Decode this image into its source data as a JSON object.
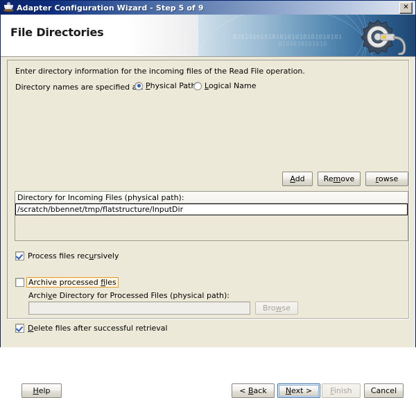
{
  "window": {
    "title": "Adapter Configuration Wizard - Step 5 of 9",
    "icon": "coffee-cup-icon",
    "close_label": "✕"
  },
  "banner": {
    "heading": "File Directories",
    "bits_row1": "0101010101010101010101010101",
    "bits_row2": "0101010101010",
    "graphic": "gear-and-plug-icon"
  },
  "body": {
    "intro_text": "Enter directory information for the incoming files of the Read File operation.",
    "spec_label": "Directory names are specified as:",
    "radios": [
      {
        "label_pre": "",
        "mnemonic": "P",
        "label_post": "hysical Path",
        "selected": true
      },
      {
        "label_pre": "",
        "mnemonic": "L",
        "label_post": "ogical Name",
        "selected": false
      }
    ]
  },
  "list_buttons": {
    "add": {
      "pre": "",
      "mnemonic": "A",
      "post": "dd"
    },
    "remove": {
      "pre": "Re",
      "mnemonic": "m",
      "post": "ove"
    },
    "browse": {
      "pre": "B",
      "mnemonic": "r",
      "post": "owse"
    }
  },
  "directory_table": {
    "column_header": "Directory for Incoming Files (physical path):",
    "rows": [
      {
        "path": "/scratch/bbennet/tmp/flatstructure/InputDir",
        "editing": true
      }
    ]
  },
  "options": {
    "process_recursively": {
      "pre": "Process files rec",
      "mnemonic": "u",
      "post": "rsively",
      "checked": true,
      "focused": false
    },
    "archive_processed": {
      "pre": "Archive processed ",
      "mnemonic": "f",
      "post": "iles",
      "checked": false,
      "focused": true
    },
    "delete_after_retrieval": {
      "pre": "",
      "mnemonic": "D",
      "post": "elete files after successful retrieval",
      "checked": true,
      "focused": false
    }
  },
  "archive_section": {
    "label_pre": "Archi",
    "label_mnemonic": "v",
    "label_post": "e Directory for Processed Files (physical path):",
    "field_value": "",
    "field_placeholder": "",
    "field_enabled": false,
    "browse": {
      "pre": "Bro",
      "mnemonic": "w",
      "post": "se",
      "enabled": false
    }
  },
  "footer_buttons": {
    "help": {
      "pre": "",
      "mnemonic": "H",
      "post": "elp",
      "enabled": true,
      "focused": false
    },
    "back": {
      "pre": "< ",
      "mnemonic": "B",
      "post": "ack",
      "enabled": true,
      "focused": false
    },
    "next": {
      "pre": "",
      "mnemonic": "N",
      "post": "ext >",
      "enabled": true,
      "focused": true
    },
    "finish": {
      "pre": "",
      "mnemonic": "F",
      "post": "inish",
      "enabled": false,
      "focused": false
    },
    "cancel": {
      "pre": "Cancel",
      "mnemonic": "",
      "post": "",
      "enabled": true,
      "focused": false
    }
  },
  "colors": {
    "titlebar_start": "#0a246a",
    "titlebar_end": "#dfe6f2",
    "dialog_face": "#ece9d8",
    "accent_check": "#2b5ab5",
    "focus_outline": "#e79a2c",
    "banner_blue": "#2b5c8c"
  }
}
